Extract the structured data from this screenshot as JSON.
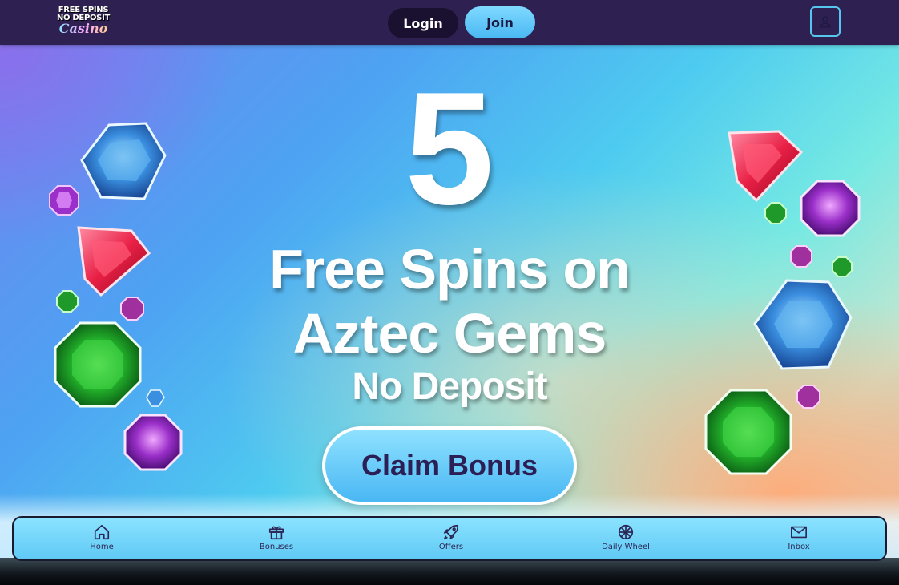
{
  "header": {
    "logo": {
      "line1": "FREE SPINS",
      "line2": "NO DEPOSIT",
      "line3": "Casino"
    },
    "login_label": "Login",
    "join_label": "Join",
    "account_icon": "user-icon"
  },
  "hero": {
    "number": "5",
    "line1": "Free Spins on",
    "line2": "Aztec Gems",
    "line3": "No Deposit",
    "cta_label": "Claim Bonus"
  },
  "nav": {
    "items": [
      {
        "label": "Home",
        "icon": "home-icon"
      },
      {
        "label": "Bonuses",
        "icon": "gift-icon"
      },
      {
        "label": "Offers",
        "icon": "rocket-icon"
      },
      {
        "label": "Daily Wheel",
        "icon": "wheel-icon"
      },
      {
        "label": "Inbox",
        "icon": "mail-icon"
      }
    ]
  },
  "colors": {
    "header_bg": "#2e2050",
    "join_bg": "#5cc4f5",
    "cta_text": "#2b1f55",
    "nav_bg": "#6fd0f8"
  }
}
